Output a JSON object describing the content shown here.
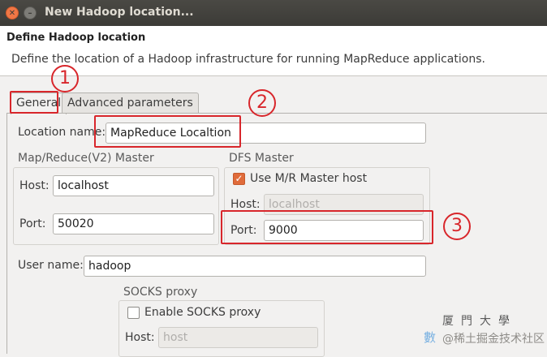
{
  "window": {
    "title": "New Hadoop location...",
    "close_glyph": "✕",
    "minimize_glyph": "–"
  },
  "header": {
    "heading": "Define Hadoop location",
    "description": "Define the location of a Hadoop infrastructure for running MapReduce applications."
  },
  "tabs": [
    {
      "label": "General",
      "active": true
    },
    {
      "label": "Advanced parameters",
      "active": false
    }
  ],
  "general": {
    "location_name_label": "Location name:",
    "location_name_value": "MapReduce Localtion",
    "mr_master": {
      "title": "Map/Reduce(V2) Master",
      "host_label": "Host:",
      "host_value": "localhost",
      "port_label": "Port:",
      "port_value": "50020"
    },
    "dfs_master": {
      "title": "DFS Master",
      "use_mr_host_label": "Use M/R Master host",
      "use_mr_host_checked": true,
      "host_label": "Host:",
      "host_value": "localhost",
      "port_label": "Port:",
      "port_value": "9000"
    },
    "user_name_label": "User name:",
    "user_name_value": "hadoop",
    "socks": {
      "title": "SOCKS proxy",
      "enable_label": "Enable SOCKS proxy",
      "enable_checked": false,
      "host_label": "Host:",
      "host_value": "host"
    }
  },
  "annotations": {
    "one": "1",
    "two": "2",
    "three": "3"
  },
  "watermark": {
    "school": "厦門大學",
    "brand_fragment": "數",
    "community": "@稀土掘金技术社区"
  },
  "colors": {
    "annotation": "#d8262b",
    "checkbox_checked": "#e06b3a",
    "titlebar": "#3c3b37"
  }
}
